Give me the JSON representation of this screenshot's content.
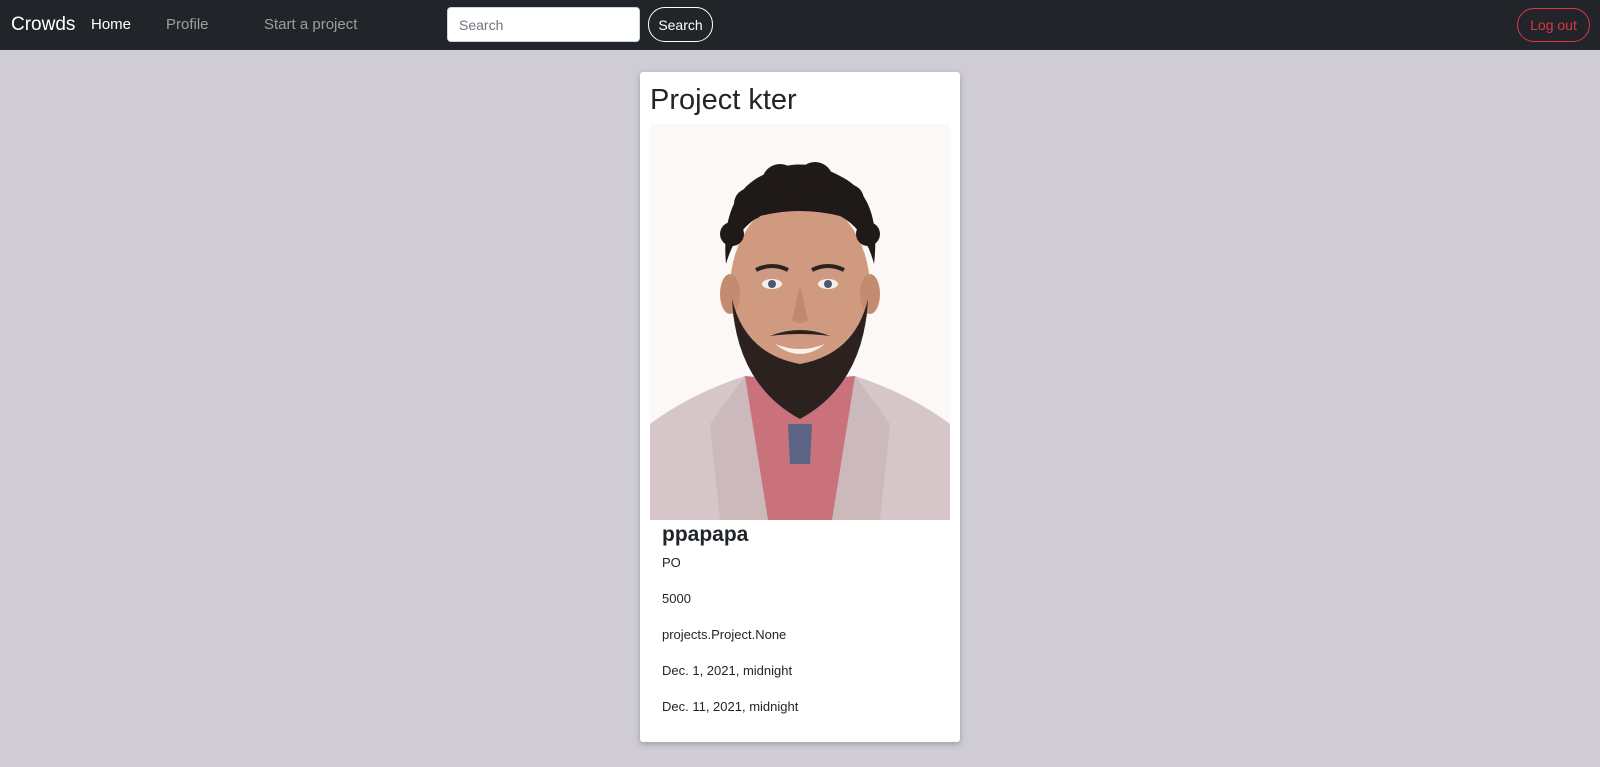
{
  "navbar": {
    "brand": "Crowds",
    "links": [
      {
        "label": "Home",
        "active": true
      },
      {
        "label": "Profile",
        "active": false
      },
      {
        "label": "Start a project",
        "active": false
      }
    ],
    "search": {
      "placeholder": "Search",
      "value": "",
      "button_label": "Search"
    },
    "logout_label": "Log out"
  },
  "colors": {
    "navbar_bg": "#212529",
    "page_bg": "#cfccd4",
    "logout_accent": "#dc3545"
  },
  "card": {
    "title": "Project kter",
    "image": {
      "name": "project-photo"
    },
    "item_title": "ppapapa",
    "description": "PO",
    "target": "5000",
    "category": "projects.Project.None",
    "start_date": "Dec. 1, 2021, midnight",
    "end_date": "Dec. 11, 2021, midnight"
  }
}
